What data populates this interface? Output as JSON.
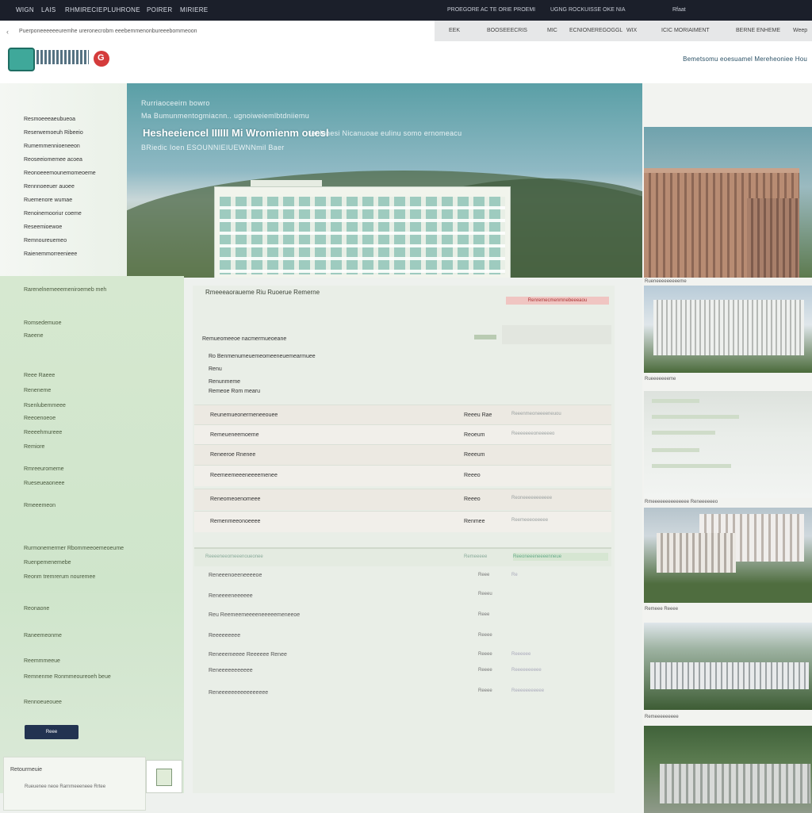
{
  "topbar": {
    "nav": [
      "WIGN",
      "LAIS",
      "RHMIRECIE",
      "PLUHRONE",
      "POIRER",
      "MIRIERE"
    ]
  },
  "topbar_right": {
    "items": [
      "PROEGORE AC TE ORIE PROEMI",
      "UGNG ROCKUISSE OKE NIA",
      "Rfaat"
    ]
  },
  "subnav": {
    "items": [
      "EEK",
      "BOOSEEECRIS",
      "MIC",
      "ECNIONEREGOGGL",
      "WIX",
      "ICIC MORIAIMENT",
      "BERNE ENHEME",
      "Weep"
    ]
  },
  "url": "Puerponeeeeeeuremhe ureronecrobm eeebemmenonbureeebommeoon",
  "tagline": "Bemetsomu eoesuamel Mereheoniee Hou",
  "hero": {
    "line1": "Rurriaoceeirn bowro",
    "line2": "Ma Bumunmentogmiacnn.. ugnoiweiemlbtdniiemu",
    "big": "Hesheeiencel IIIIII Mi Wromienm ouesl",
    "line3": "Ienlonesi Nicanuoae eulinu somo ernomeacu",
    "line4": "BRiedic Ioen ESOUNNIEIUEWNNmil Baer"
  },
  "menu": [
    "Resmoeeeaeubueoa",
    "Reserwemoeuh Ribeeio",
    "Rumemmennioeneeon",
    "Reoseeiomemee acoea",
    "Reonoeeemounemomeoeme",
    "Rennnoeeuer auoee",
    "Ruemenore wumae",
    "Renoinemooriur coeme",
    "Reseemioewoe",
    "Remnoureuemeo",
    "Raienemmorreenieee"
  ],
  "sidebar": {
    "items": [
      "Rarenelnemeeemeniroemeb meh",
      "Romsedemuoe",
      "Raeene",
      "Reee Raeee",
      "Reneneme",
      "Rsenlubemmeee",
      "Reeoenoeoe",
      "Reeeehmureee",
      "Remiore",
      "Rmreeuromeme",
      "Rueseueaoneee",
      "Rmeeemeon",
      "Rurmonemermer Rbommeeoemeoeume",
      "Ruenpemenemebe",
      "Reonm tremrerum nouremee",
      "Reonaone",
      "Raneemeonme",
      "Reemmmeeue",
      "Remnenme Ronmmeoureoeh beue",
      "Rennoeueouee"
    ],
    "button": "Reee"
  },
  "footer": {
    "title": "Retourmeuie",
    "sub": "Rueuenee neoe Rarnmeeeneee Rrtee"
  },
  "main": {
    "title": "Rmeeeaoraueme Riu Ruoerue Remerne",
    "badge": "Renremecmenmnebeeeaou",
    "section": "Remueomeeoe nacmermueoeane",
    "address": [
      "Ro Benmenumeuemeomeeneuemearmuee",
      "Renu",
      "Renunmeme",
      "Remeoe Rom mearu"
    ],
    "rows": [
      {
        "name": "Reunemueonermeneeouee",
        "val": "Reeeu Rae",
        "meta": "Reeenmeoneeeeneuou"
      },
      {
        "name": "Remeueneemoeme",
        "val": "Reoeum",
        "meta": "Reeeeeeeoneeeeeo"
      },
      {
        "name": "Reneeroe Rnenee",
        "val": "Reeeum",
        "meta": ""
      },
      {
        "name": "Reemeemeeeneeeemenee",
        "val": "Reeeo",
        "meta": ""
      },
      {
        "name": "Reneomeoenomeee",
        "val": "Reeeo",
        "meta": "Reoneeeeeeeeeee"
      },
      {
        "name": "Remenmeeonoeeee",
        "val": "Renmee",
        "meta": "Reemeeeoeeeee"
      }
    ],
    "table2_head": [
      "Reeeeneeomeeenoueonee",
      "Remeeeee",
      "Reeoneeeneeeenneue"
    ],
    "table2": [
      {
        "name": "Reneeenoeeneeeeoe",
        "val": "Reee",
        "meta": "Re"
      },
      {
        "name": "Reneeeeneeeeee",
        "val": "Reeeu",
        "meta": ""
      },
      {
        "name": "Reu Reemeemeeeeneeeeemeneeoe",
        "val": "Reee",
        "meta": ""
      },
      {
        "name": "Reeeeeeeee",
        "val": "Reeee",
        "meta": ""
      },
      {
        "name": "Reneeemeeee Reeeeee Renee",
        "val": "Reeee",
        "meta": "Reeeeee"
      },
      {
        "name": "Reneeeeeeeeeee",
        "val": "Reeee",
        "meta": "Reeeeeeeeee"
      },
      {
        "name": "Reneeeeeeeeeeeeeeee",
        "val": "Reeee",
        "meta": "Reeeeeeeeeee"
      }
    ]
  },
  "rightcol": {
    "captions": [
      "Rueneeeeeeeeeme",
      "Rueeeeeeeme",
      "Rmeeeeeeeeeeeeee Reneeeeeeo",
      "Remeee Reeee",
      "Remeeeeeeeee"
    ]
  }
}
